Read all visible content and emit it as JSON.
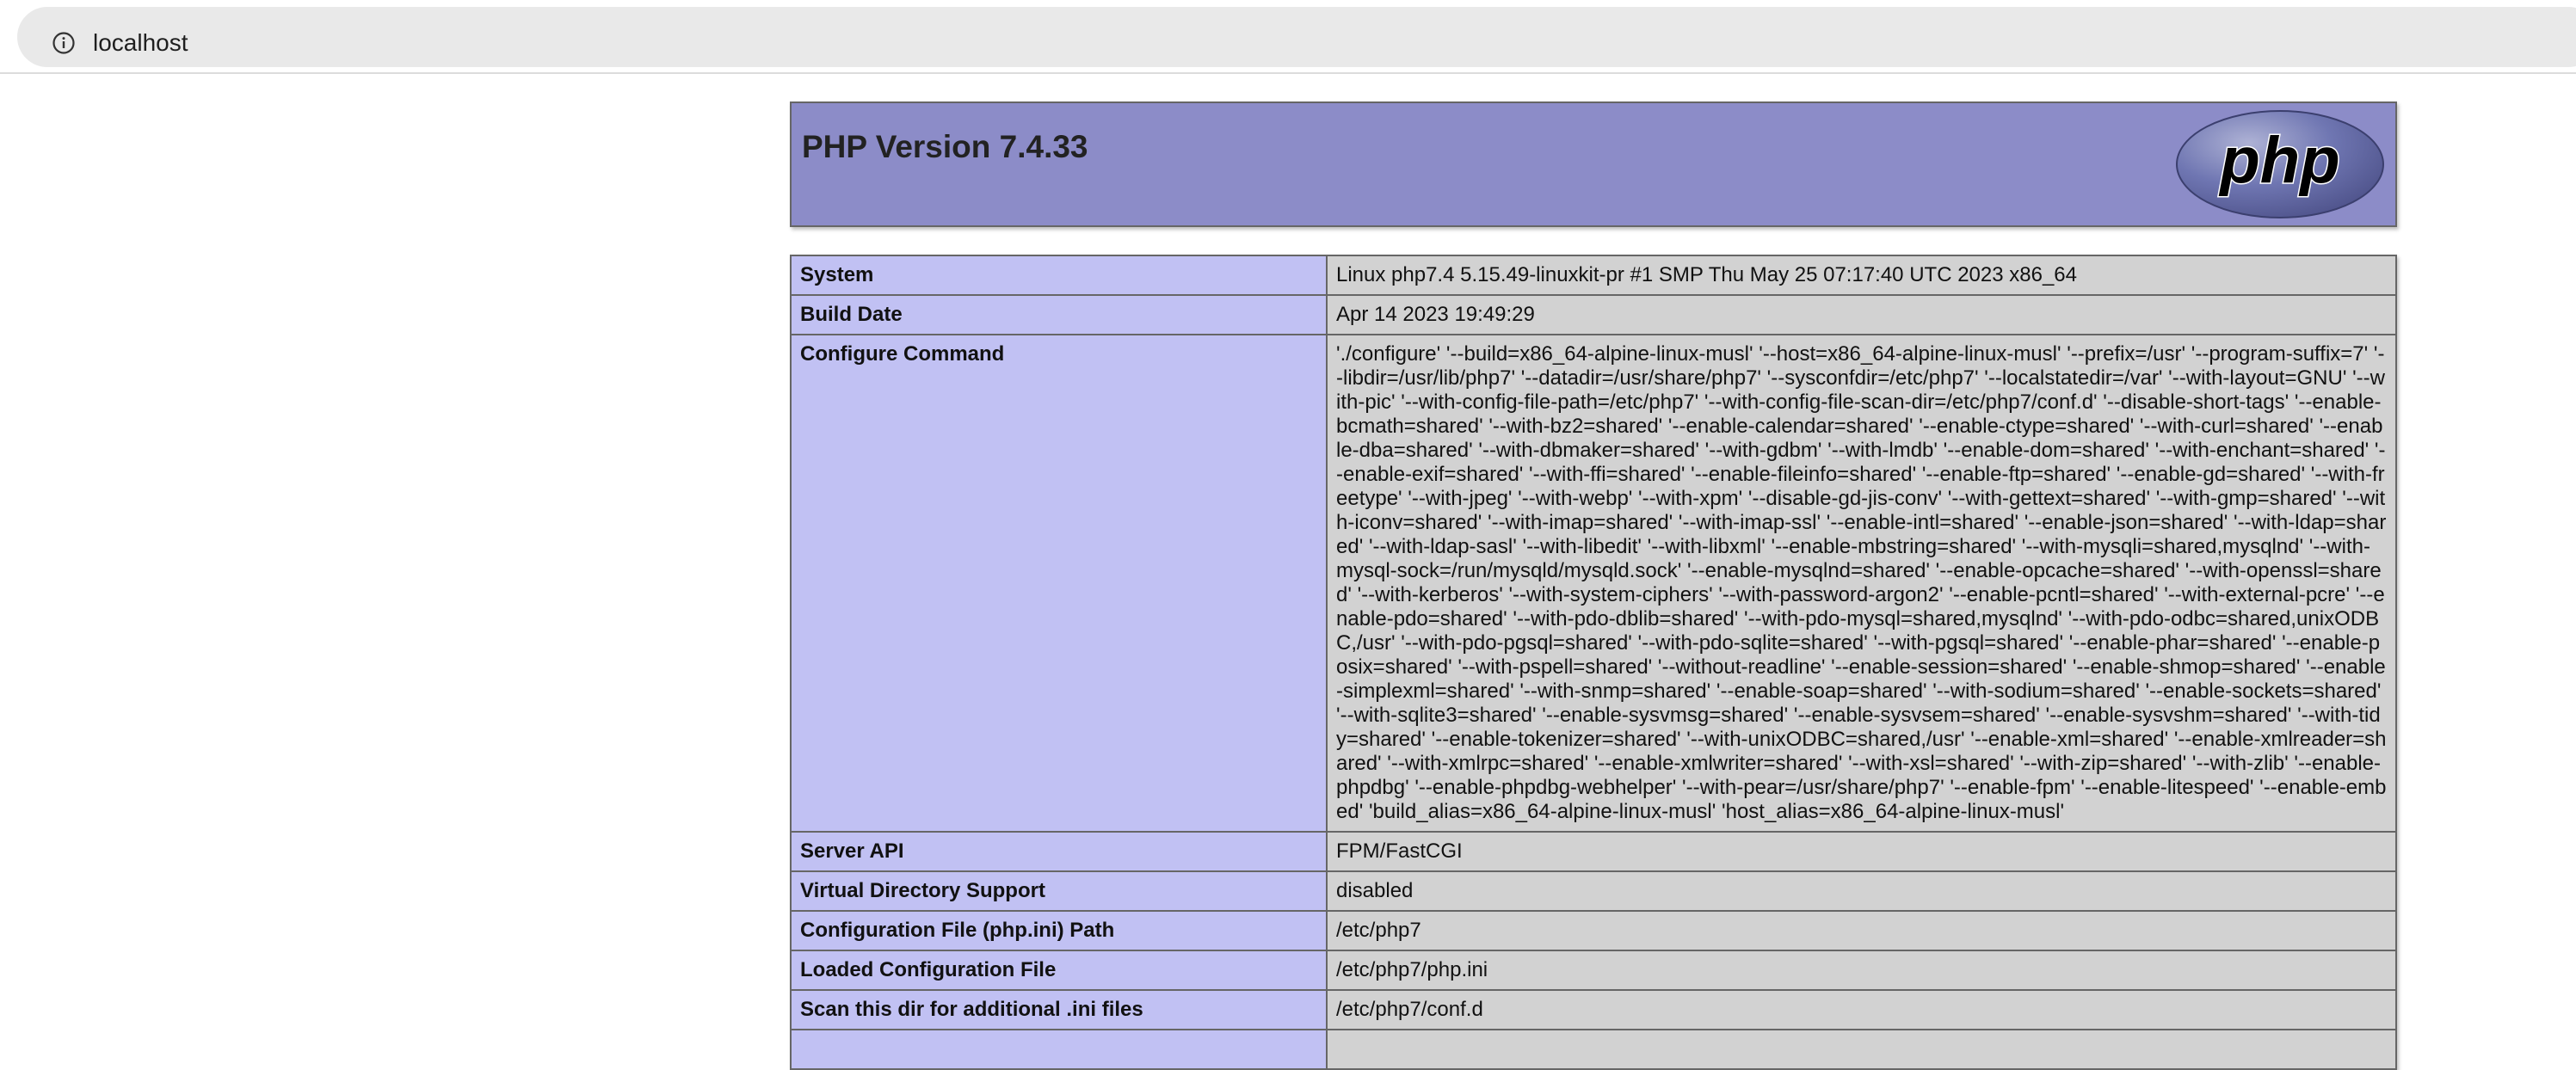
{
  "browser": {
    "url": "localhost",
    "info_icon": "info-icon"
  },
  "php": {
    "title": "PHP Version 7.4.33",
    "logo_text": "php"
  },
  "rows": [
    {
      "label": "System",
      "value": "Linux php7.4 5.15.49-linuxkit-pr #1 SMP Thu May 25 07:17:40 UTC 2023 x86_64"
    },
    {
      "label": "Build Date",
      "value": "Apr 14 2023 19:49:29"
    },
    {
      "label": "Configure Command",
      "value": "'./configure' '--build=x86_64-alpine-linux-musl' '--host=x86_64-alpine-linux-musl' '--prefix=/usr' '--program-suffix=7' '--libdir=/usr/lib/php7' '--datadir=/usr/share/php7' '--sysconfdir=/etc/php7' '--localstatedir=/var' '--with-layout=GNU' '--with-pic' '--with-config-file-path=/etc/php7' '--with-config-file-scan-dir=/etc/php7/conf.d' '--disable-short-tags' '--enable-bcmath=shared' '--with-bz2=shared' '--enable-calendar=shared' '--enable-ctype=shared' '--with-curl=shared' '--enable-dba=shared' '--with-dbmaker=shared' '--with-gdbm' '--with-lmdb' '--enable-dom=shared' '--with-enchant=shared' '--enable-exif=shared' '--with-ffi=shared' '--enable-fileinfo=shared' '--enable-ftp=shared' '--enable-gd=shared' '--with-freetype' '--with-jpeg' '--with-webp' '--with-xpm' '--disable-gd-jis-conv' '--with-gettext=shared' '--with-gmp=shared' '--with-iconv=shared' '--with-imap=shared' '--with-imap-ssl' '--enable-intl=shared' '--enable-json=shared' '--with-ldap=shared' '--with-ldap-sasl' '--with-libedit' '--with-libxml' '--enable-mbstring=shared' '--with-mysqli=shared,mysqlnd' '--with-mysql-sock=/run/mysqld/mysqld.sock' '--enable-mysqlnd=shared' '--enable-opcache=shared' '--with-openssl=shared' '--with-kerberos' '--with-system-ciphers' '--with-password-argon2' '--enable-pcntl=shared' '--with-external-pcre' '--enable-pdo=shared' '--with-pdo-dblib=shared' '--with-pdo-mysql=shared,mysqlnd' '--with-pdo-odbc=shared,unixODBC,/usr' '--with-pdo-pgsql=shared' '--with-pdo-sqlite=shared' '--with-pgsql=shared' '--enable-phar=shared' '--enable-posix=shared' '--with-pspell=shared' '--without-readline' '--enable-session=shared' '--enable-shmop=shared' '--enable-simplexml=shared' '--with-snmp=shared' '--enable-soap=shared' '--with-sodium=shared' '--enable-sockets=shared' '--with-sqlite3=shared' '--enable-sysvmsg=shared' '--enable-sysvsem=shared' '--enable-sysvshm=shared' '--with-tidy=shared' '--enable-tokenizer=shared' '--with-unixODBC=shared,/usr' '--enable-xml=shared' '--enable-xmlreader=shared' '--with-xmlrpc=shared' '--enable-xmlwriter=shared' '--with-xsl=shared' '--with-zip=shared' '--with-zlib' '--enable-phpdbg' '--enable-phpdbg-webhelper' '--with-pear=/usr/share/php7' '--enable-fpm' '--enable-litespeed' '--enable-embed' 'build_alias=x86_64-alpine-linux-musl' 'host_alias=x86_64-alpine-linux-musl'"
    },
    {
      "label": "Server API",
      "value": "FPM/FastCGI"
    },
    {
      "label": "Virtual Directory Support",
      "value": "disabled"
    },
    {
      "label": "Configuration File (php.ini) Path",
      "value": "/etc/php7"
    },
    {
      "label": "Loaded Configuration File",
      "value": "/etc/php7/php.ini"
    },
    {
      "label": "Scan this dir for additional .ini files",
      "value": "/etc/php7/conf.d"
    },
    {
      "label": "",
      "value": ""
    }
  ]
}
